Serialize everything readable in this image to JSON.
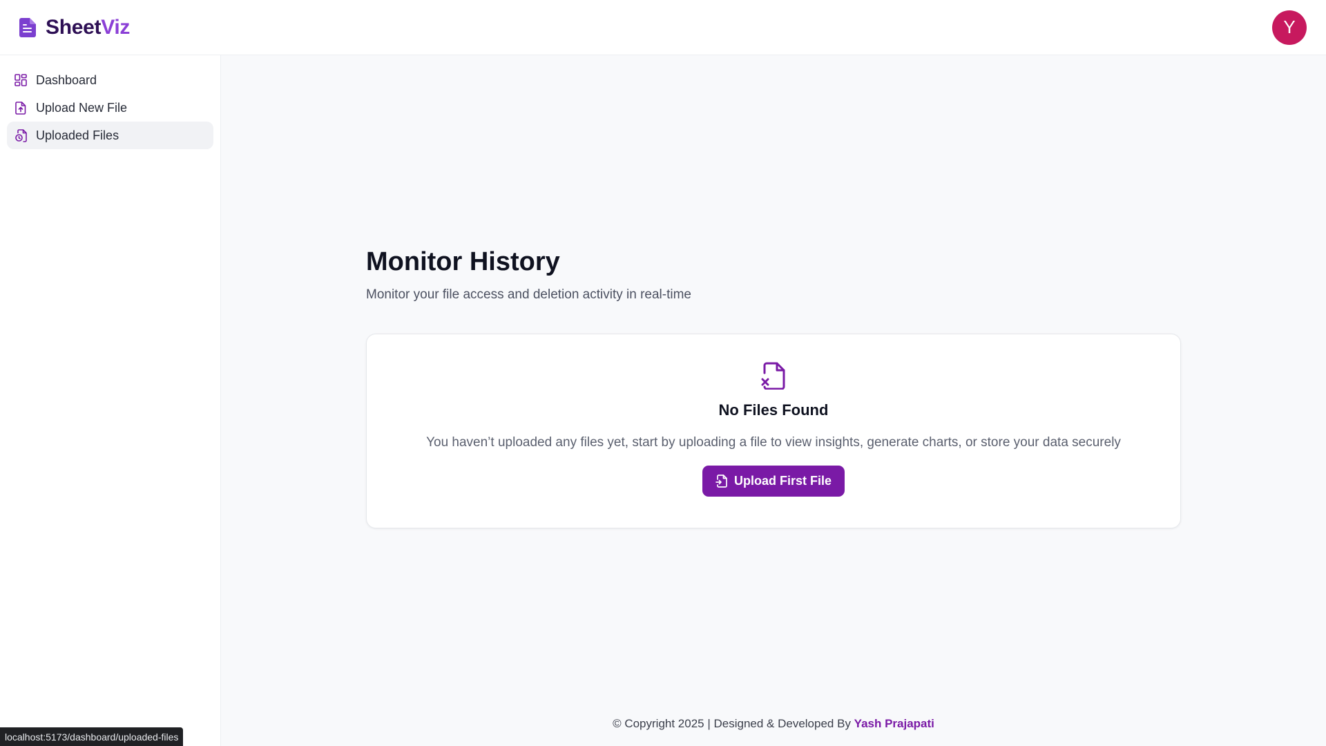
{
  "app": {
    "brand_part1": "Sheet",
    "brand_part2": "Viz",
    "avatar_initial": "Y",
    "brand_color": "#7a1aa6",
    "avatar_color": "#c7195e"
  },
  "sidebar": {
    "items": [
      {
        "label": "Dashboard",
        "icon": "dashboard-grid-icon",
        "active": false
      },
      {
        "label": "Upload New File",
        "icon": "file-upload-icon",
        "active": false
      },
      {
        "label": "Uploaded Files",
        "icon": "file-history-icon",
        "active": true
      }
    ]
  },
  "main": {
    "title": "Monitor History",
    "subtitle": "Monitor your file access and deletion activity in real-time",
    "empty_state": {
      "icon": "file-x-icon",
      "title": "No Files Found",
      "description": "You haven’t uploaded any files yet, start by uploading a file to view insights, generate charts, or store your data securely",
      "button_label": "Upload First File",
      "button_icon": "file-upload-icon"
    }
  },
  "footer": {
    "text": "© Copyright 2025 | Designed & Developed By ",
    "author": "Yash Prajapati"
  },
  "status_bar": {
    "url": "localhost:5173/dashboard/uploaded-files"
  }
}
